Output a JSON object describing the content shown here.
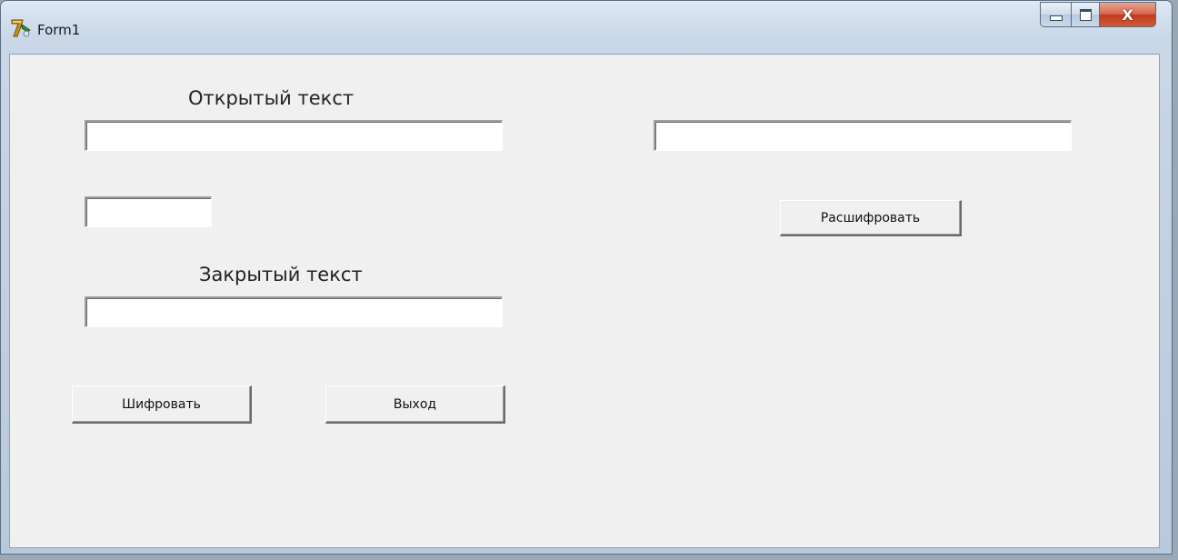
{
  "window": {
    "title": "Form1",
    "icon": "delphi-app-icon",
    "caption_buttons": [
      "minimize-icon",
      "maximize-icon",
      "close-icon"
    ]
  },
  "form": {
    "plain_text_label": "Открытый текст",
    "plain_text_value": "",
    "key_value": "",
    "cipher_text_label": "Закрытый текст",
    "cipher_text_value": "",
    "decrypted_value": "",
    "encrypt_button": "Шифровать",
    "exit_button": "Выход",
    "decrypt_button": "Расшифровать"
  }
}
